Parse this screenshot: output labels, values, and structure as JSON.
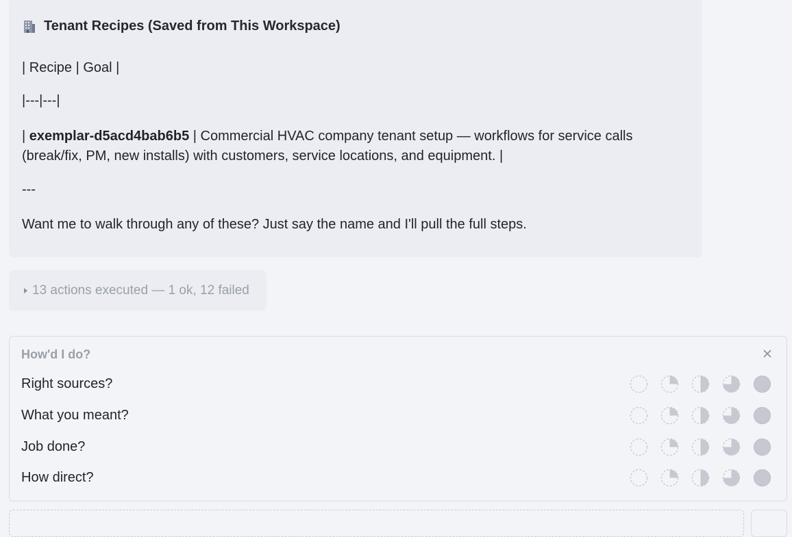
{
  "message": {
    "heading_icon": "building-icon",
    "heading": "Tenant Recipes (Saved from This Workspace)",
    "table_header": "| Recipe | Goal |",
    "table_separator": "|---|---|",
    "row_prefix": "| ",
    "row_recipe": "exemplar-d5acd4bab6b5",
    "row_text_line1": " | Commercial HVAC company tenant setup — workflows for service calls",
    "row_text_line2": "(break/fix, PM, new installs) with customers, service locations, and equipment. |",
    "hr": "---",
    "closing": "Want me to walk through any of these? Just say the name and I'll pull the full steps."
  },
  "actions": {
    "summary": "13 actions executed — 1 ok, 12 failed"
  },
  "feedback": {
    "title": "How'd I do?",
    "close_icon": "close-icon",
    "questions": [
      "Right sources?",
      "What you meant?",
      "Job done?",
      "How direct?"
    ],
    "scale_icons": [
      "empty-circle-icon",
      "quarter-circle-icon",
      "half-circle-icon",
      "three-quarter-circle-icon",
      "full-circle-icon"
    ],
    "scale_values": [
      0,
      0.25,
      0.5,
      0.75,
      1
    ]
  },
  "colors": {
    "card_bg": "#ebedf3",
    "muted_text": "#9aa0a8",
    "rating_fill": "#c6c9d1"
  }
}
